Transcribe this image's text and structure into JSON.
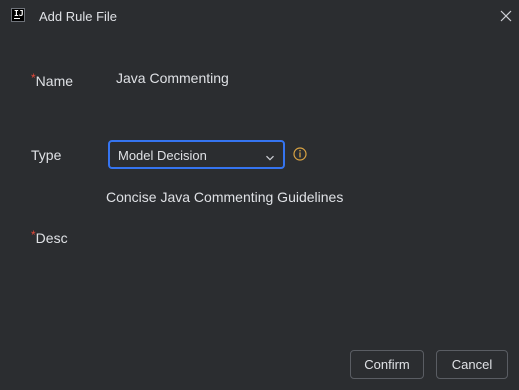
{
  "window": {
    "title": "Add Rule File",
    "app_icon_text": "IJ",
    "app_icon_name": "intellij-icon",
    "close_icon_name": "close-icon"
  },
  "form": {
    "required_marker": "*",
    "name_label": "Name",
    "name_value": "Java Commenting",
    "type_label": "Type",
    "type_selected": "Model Decision",
    "type_dropdown_icon": "chevron-down-icon",
    "type_info_icon": "info-icon",
    "description_value": "Concise Java Commenting Guidelines",
    "desc_label": "Desc"
  },
  "buttons": {
    "confirm": "Confirm",
    "cancel": "Cancel"
  },
  "colors": {
    "background": "#2b2d30",
    "text": "#dfe1e5",
    "required_marker": "#e5493a",
    "focus_border": "#3574f0",
    "info_icon": "#d9a343",
    "button_border": "#5a5d63"
  }
}
